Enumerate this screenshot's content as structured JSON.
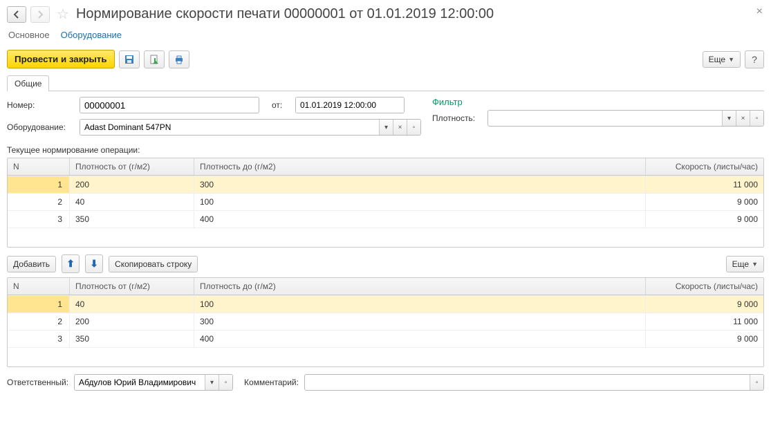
{
  "header": {
    "title": "Нормирование скорости печати 00000001 от 01.01.2019 12:00:00"
  },
  "topTabs": {
    "main": "Основное",
    "equipment": "Оборудование"
  },
  "toolbar": {
    "postAndClose": "Провести и закрыть",
    "more": "Еще",
    "help": "?"
  },
  "tab": {
    "general": "Общие"
  },
  "form": {
    "numberLabel": "Номер:",
    "numberValue": "00000001",
    "fromLabel": "от:",
    "dateValue": "01.01.2019 12:00:00",
    "equipmentLabel": "Оборудование:",
    "equipmentValue": "Adast Dominant 547PN"
  },
  "filter": {
    "title": "Фильтр",
    "densityLabel": "Плотность:",
    "densityValue": ""
  },
  "currentLabel": "Текущее нормирование операции:",
  "gridHeaders": {
    "n": "N",
    "from": "Плотность от (г/м2)",
    "to": "Плотность до (г/м2)",
    "speed": "Скорость (листы/час)"
  },
  "grid1": [
    {
      "n": "1",
      "from": "200",
      "to": "300",
      "speed": "11 000"
    },
    {
      "n": "2",
      "from": "40",
      "to": "100",
      "speed": "9 000"
    },
    {
      "n": "3",
      "from": "350",
      "to": "400",
      "speed": "9 000"
    }
  ],
  "midToolbar": {
    "add": "Добавить",
    "copyRow": "Скопировать строку",
    "more": "Еще"
  },
  "grid2": [
    {
      "n": "1",
      "from": "40",
      "to": "100",
      "speed": "9 000"
    },
    {
      "n": "2",
      "from": "200",
      "to": "300",
      "speed": "11 000"
    },
    {
      "n": "3",
      "from": "350",
      "to": "400",
      "speed": "9 000"
    }
  ],
  "footer": {
    "responsibleLabel": "Ответственный:",
    "responsibleValue": "Абдулов Юрий Владимирович",
    "commentLabel": "Комментарий:",
    "commentValue": ""
  }
}
